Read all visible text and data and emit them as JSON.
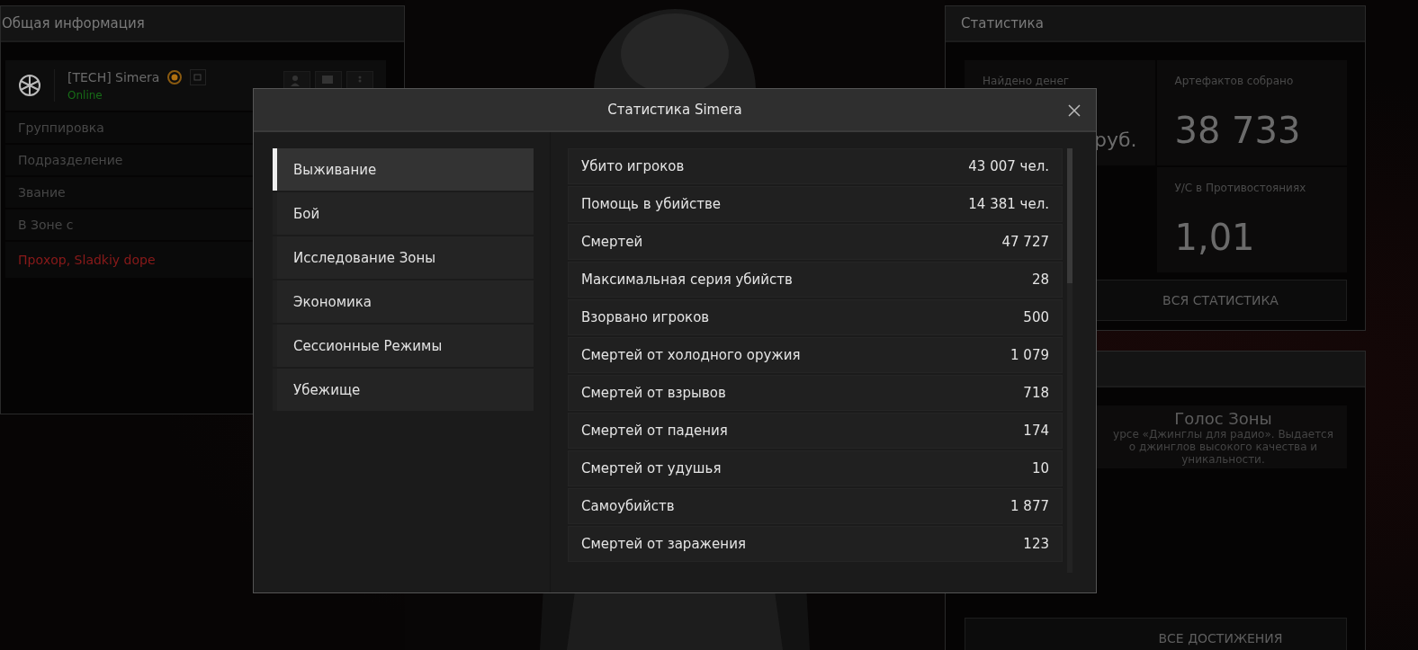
{
  "general_panel": {
    "title": "Общая информация",
    "player": {
      "name": "[TECH] Simera",
      "status": "Online"
    },
    "rows": [
      {
        "label": "Группировка"
      },
      {
        "label": "Подразделение"
      },
      {
        "label": "Звание"
      },
      {
        "label": "В Зоне с"
      }
    ],
    "alert": "Прохор, Sladkiy dope"
  },
  "stats_panel": {
    "title": "Статистика",
    "cards": [
      {
        "label": "Найдено денег",
        "value": "руб."
      },
      {
        "label": "Артефактов собрано",
        "value": "38 733"
      },
      {
        "label": "У/С в Противостояниях",
        "value": "1,01"
      }
    ],
    "button": "ВСЯ СТАТИСТИКА"
  },
  "achievements_panel": {
    "achievement": {
      "title": "Голос Зоны",
      "description_lines": [
        "урсе «Джинглы для радио». Выдается",
        "о джинглов высокого качества и",
        "уникальности."
      ]
    },
    "button": "ВСЕ ДОСТИЖЕНИЯ"
  },
  "dialog": {
    "title": "Статистика Simera",
    "tabs": [
      {
        "label": "Выживание",
        "selected": true
      },
      {
        "label": "Бой",
        "selected": false
      },
      {
        "label": "Исследование Зоны",
        "selected": false
      },
      {
        "label": "Экономика",
        "selected": false
      },
      {
        "label": "Сессионные Режимы",
        "selected": false
      },
      {
        "label": "Убежище",
        "selected": false
      }
    ],
    "rows": [
      {
        "label": "Убито игроков",
        "value": "43 007 чел."
      },
      {
        "label": "Помощь в убийстве",
        "value": "14 381 чел."
      },
      {
        "label": "Смертей",
        "value": "47 727"
      },
      {
        "label": "Максимальная серия убийств",
        "value": "28"
      },
      {
        "label": "Взорвано игроков",
        "value": "500"
      },
      {
        "label": "Смертей от холодного оружия",
        "value": "1 079"
      },
      {
        "label": "Смертей от взрывов",
        "value": "718"
      },
      {
        "label": "Смертей от падения",
        "value": "174"
      },
      {
        "label": "Смертей от удушья",
        "value": "10"
      },
      {
        "label": "Самоубийств",
        "value": "1 877"
      },
      {
        "label": "Смертей от заражения",
        "value": "123"
      }
    ]
  }
}
